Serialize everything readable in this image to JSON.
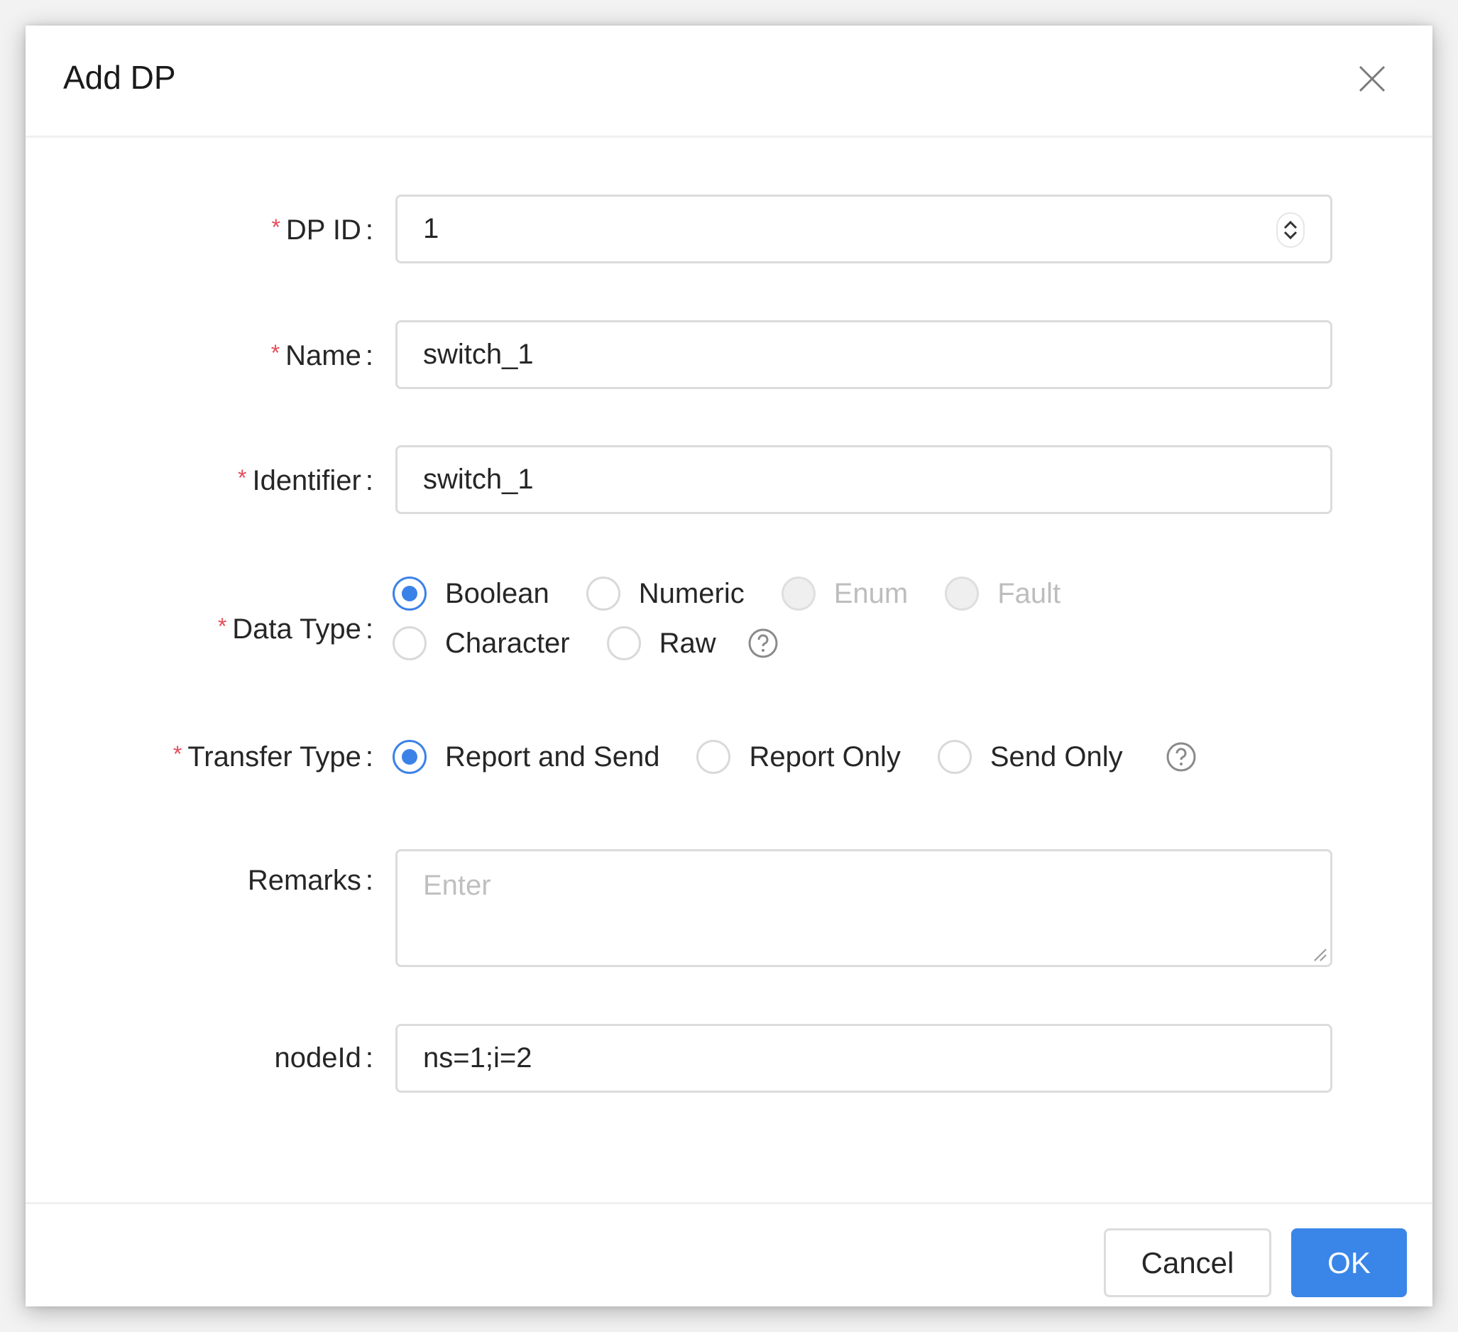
{
  "dialog": {
    "title": "Add DP",
    "close_icon": "close-icon"
  },
  "form": {
    "dp_id": {
      "label": "DP ID",
      "required": true,
      "value": "1",
      "icon": "stepper-icon"
    },
    "name": {
      "label": "Name",
      "required": true,
      "value": "switch_1"
    },
    "identifier": {
      "label": "Identifier",
      "required": true,
      "value": "switch_1"
    },
    "data_type": {
      "label": "Data Type",
      "required": true,
      "options": [
        {
          "label": "Boolean",
          "checked": true,
          "disabled": false
        },
        {
          "label": "Numeric",
          "checked": false,
          "disabled": false
        },
        {
          "label": "Enum",
          "checked": false,
          "disabled": true
        },
        {
          "label": "Fault",
          "checked": false,
          "disabled": true
        },
        {
          "label": "Character",
          "checked": false,
          "disabled": false
        },
        {
          "label": "Raw",
          "checked": false,
          "disabled": false
        }
      ],
      "help_icon": "help-circle-icon"
    },
    "transfer_type": {
      "label": "Transfer Type",
      "required": true,
      "options": [
        {
          "label": "Report and Send",
          "checked": true
        },
        {
          "label": "Report Only",
          "checked": false
        },
        {
          "label": "Send Only",
          "checked": false
        }
      ],
      "help_icon": "help-circle-icon"
    },
    "remarks": {
      "label": "Remarks",
      "required": false,
      "value": "",
      "placeholder": "Enter"
    },
    "node_id": {
      "label": "nodeId",
      "required": false,
      "value": "ns=1;i=2"
    },
    "colon": ":",
    "required_mark": "*"
  },
  "footer": {
    "cancel_label": "Cancel",
    "ok_label": "OK"
  },
  "colors": {
    "primary": "#3a86e8",
    "required": "#e34d59",
    "border": "#dcdcdc",
    "disabled_text": "#bdbdbd"
  }
}
